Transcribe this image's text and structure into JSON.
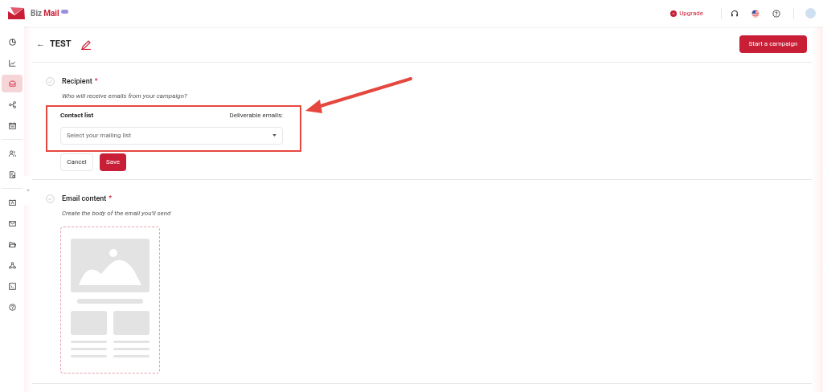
{
  "header": {
    "brand_first": "Biz",
    "brand_second": "Mail",
    "upgrade": "Upgrade"
  },
  "sidebar": {
    "items": [
      {
        "selected": false
      },
      {
        "selected": false
      },
      {
        "selected": true
      },
      {
        "selected": false
      },
      {
        "selected": false
      },
      {
        "selected": false
      },
      {
        "selected": false
      },
      {
        "selected": false
      },
      {
        "selected": false
      },
      {
        "selected": false
      },
      {
        "selected": false
      },
      {
        "selected": false
      },
      {
        "selected": false
      }
    ],
    "toggle": ">"
  },
  "page": {
    "back": "←",
    "title": "TEST",
    "primary_button": "Start a campaign"
  },
  "sections": [
    {
      "kind": "recipient",
      "title": "Recipient",
      "required": "*",
      "subtitle": "Who will receive emails from your campaign?",
      "field_label": "Contact list",
      "field_info": "Deliverable emails:",
      "placeholder": "Select your mailing list",
      "cancel": "Cancel",
      "save": "Save"
    },
    {
      "kind": "content",
      "title": "Email content",
      "required": "*",
      "subtitle": "Create the body of the email you'll send"
    }
  ]
}
